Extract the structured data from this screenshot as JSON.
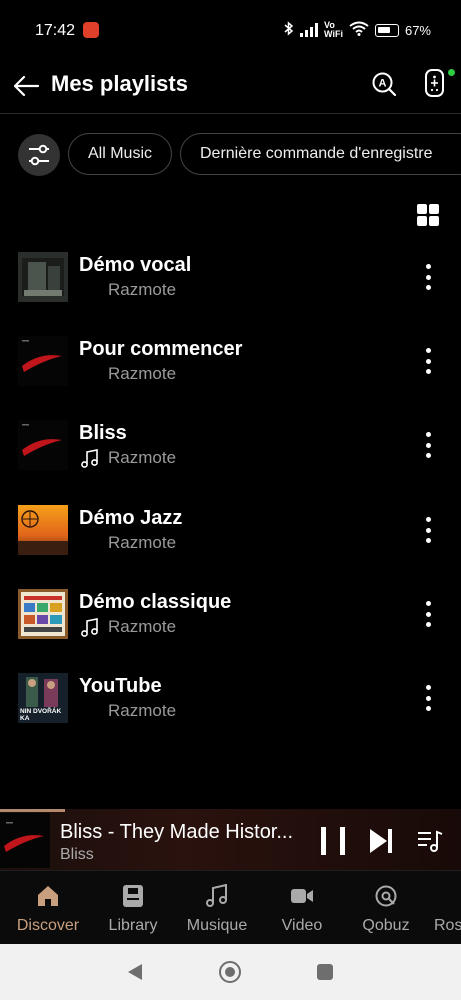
{
  "status_bar": {
    "time": "17:42",
    "network_label": "Vo\nWiFi",
    "battery_percent": "67%",
    "battery_level": 0.67
  },
  "header": {
    "title": "Mes playlists",
    "remote_status_color": "#2ecc40"
  },
  "filters": {
    "chips": [
      "All Music",
      "Dernière commande d'enregistre"
    ]
  },
  "playlists": [
    {
      "title": "Démo vocal",
      "subtitle": "Razmote",
      "has_note_icon": false,
      "cover": "vocal"
    },
    {
      "title": "Pour commencer",
      "subtitle": "Razmote",
      "has_note_icon": false,
      "cover": "red-swoosh"
    },
    {
      "title": "Bliss",
      "subtitle": "Razmote",
      "has_note_icon": true,
      "cover": "red-swoosh"
    },
    {
      "title": "Démo Jazz",
      "subtitle": "Razmote",
      "has_note_icon": false,
      "cover": "sunset"
    },
    {
      "title": "Démo classique",
      "subtitle": "Razmote",
      "has_note_icon": true,
      "cover": "classic-grid"
    },
    {
      "title": "YouTube",
      "subtitle": "Razmote",
      "has_note_icon": false,
      "cover": "youtube",
      "cover_text": "NIN DVOŘÁK\nKA"
    }
  ],
  "player": {
    "title": "Bliss - They Made Histor...",
    "artist": "Bliss",
    "progress": 0.14
  },
  "bottom_nav": [
    {
      "label": "Discover",
      "icon": "home-icon",
      "active": true
    },
    {
      "label": "Library",
      "icon": "library-icon",
      "active": false
    },
    {
      "label": "Musique",
      "icon": "music-note-icon",
      "active": false
    },
    {
      "label": "Video",
      "icon": "video-icon",
      "active": false
    },
    {
      "label": "Qobuz",
      "icon": "qobuz-icon",
      "active": false
    },
    {
      "label": "Ros",
      "icon": "generic-icon",
      "active": false
    }
  ],
  "colors": {
    "accent": "#c8a07f",
    "background": "#000000",
    "secondary_text": "#9a9a9a"
  }
}
